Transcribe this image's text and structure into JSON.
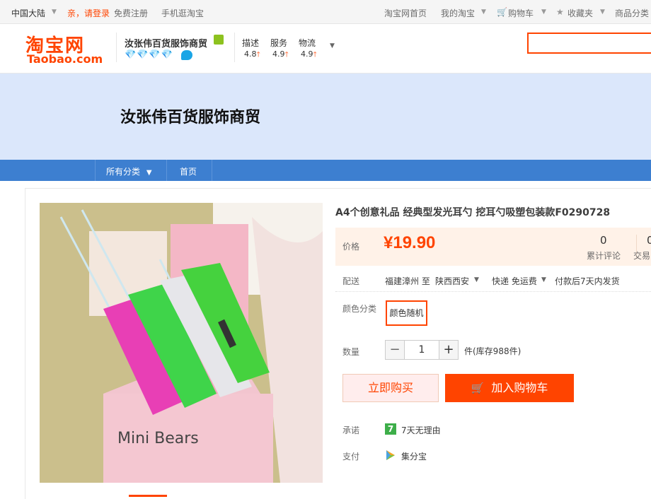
{
  "topbar": {
    "region": "中国大陆",
    "login": "亲，请登录",
    "register": "免费注册",
    "mobile": "手机逛淘宝",
    "home": "淘宝网首页",
    "my_taobao": "我的淘宝",
    "cart": "购物车",
    "favorites": "收藏夹",
    "categories": "商品分类"
  },
  "header": {
    "logo_cn": "淘宝网",
    "logo_en": "Taobao.com",
    "shop_name": "汝张伟百货服饰商贸",
    "ratings": [
      {
        "label": "描述",
        "value": "4.8"
      },
      {
        "label": "服务",
        "value": "4.9"
      },
      {
        "label": "物流",
        "value": "4.9"
      }
    ]
  },
  "banner": {
    "shop_title": "汝张伟百货服饰商贸"
  },
  "nav": {
    "all_categories": "所有分类",
    "home": "首页"
  },
  "product": {
    "title": "A4个创意礼品 经典型发光耳勺 挖耳勺吸塑包装款F0290728",
    "price_label": "价格",
    "price": "¥19.90",
    "reviews_count": "0",
    "reviews_label": "累计评论",
    "trade_count": "0",
    "trade_label": "交易",
    "delivery_label": "配送",
    "delivery_from": "福建漳州 至",
    "delivery_to": "陕西西安",
    "shipping": "快递 免运费",
    "dispatch": "付款后7天内发货",
    "color_label": "颜色分类",
    "color_option": "颜色随机",
    "qty_label": "数量",
    "qty_minus": "−",
    "qty_value": "1",
    "qty_plus": "+",
    "stock": "件(库存988件)",
    "buy_now": "立即购买",
    "add_to_cart": "加入购物车",
    "promise_label": "承诺",
    "promise_icon_text": "7",
    "promise_text": "7天无理由",
    "pay_label": "支付",
    "pay_text": "集分宝"
  },
  "colors": {
    "brand": "#ff4400",
    "nav_blue": "#3d7fd0",
    "banner_bg": "#dbe7fb"
  }
}
